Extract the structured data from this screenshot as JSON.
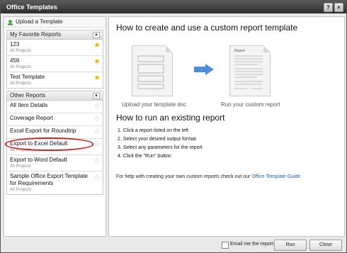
{
  "window": {
    "title": "Office Templates",
    "help_label": "?",
    "close_label": "×"
  },
  "left_panel": {
    "upload_label": "Upload a Template",
    "favorites": {
      "heading": "My Favorite Reports",
      "items": [
        {
          "name": "123",
          "sub": "All Projects",
          "starred": true
        },
        {
          "name": "456",
          "sub": "All Projects",
          "starred": true
        },
        {
          "name": "Test Template",
          "sub": "All Projects",
          "starred": true
        }
      ]
    },
    "other": {
      "heading": "Other Reports",
      "items": [
        {
          "name": "All Item Details",
          "sub": "",
          "starred": false
        },
        {
          "name": "Coverage Report",
          "sub": "",
          "starred": false
        },
        {
          "name": "Excel Export for Roundtrip",
          "sub": "",
          "starred": false
        },
        {
          "name": "Export to Excel Default",
          "sub": "All Projects",
          "starred": false
        },
        {
          "name": "Export to Word Default",
          "sub": "All Projects",
          "starred": false
        },
        {
          "name": "Sample Office Export Template for Requirements",
          "sub": "All Projects",
          "starred": false
        }
      ]
    },
    "collapse_glyph": "▲",
    "star_glyph": "★",
    "star_empty_glyph": "☆"
  },
  "main": {
    "heading_create": "How to create and use a custom report template",
    "caption_upload": "Upload your template doc",
    "caption_run": "Run your custom report",
    "doc_report_title": "Report",
    "heading_run": "How to run an existing report",
    "steps": [
      "1.  Click a report listed on the left",
      "2.  Select your desired output format",
      "3.  Select any parameters for the report",
      "4.  Click the \"Run\" button"
    ],
    "help_text": "For help with creating your own custom reports check out our",
    "help_link": "Office Template Guide"
  },
  "footer": {
    "email_label": "Email me the report",
    "run_label": "Run",
    "close_label": "Close"
  },
  "colors": {
    "accent_arrow": "#4a8fd9",
    "link": "#1560b8",
    "highlight": "#cc2222",
    "star": "#f0b400"
  }
}
